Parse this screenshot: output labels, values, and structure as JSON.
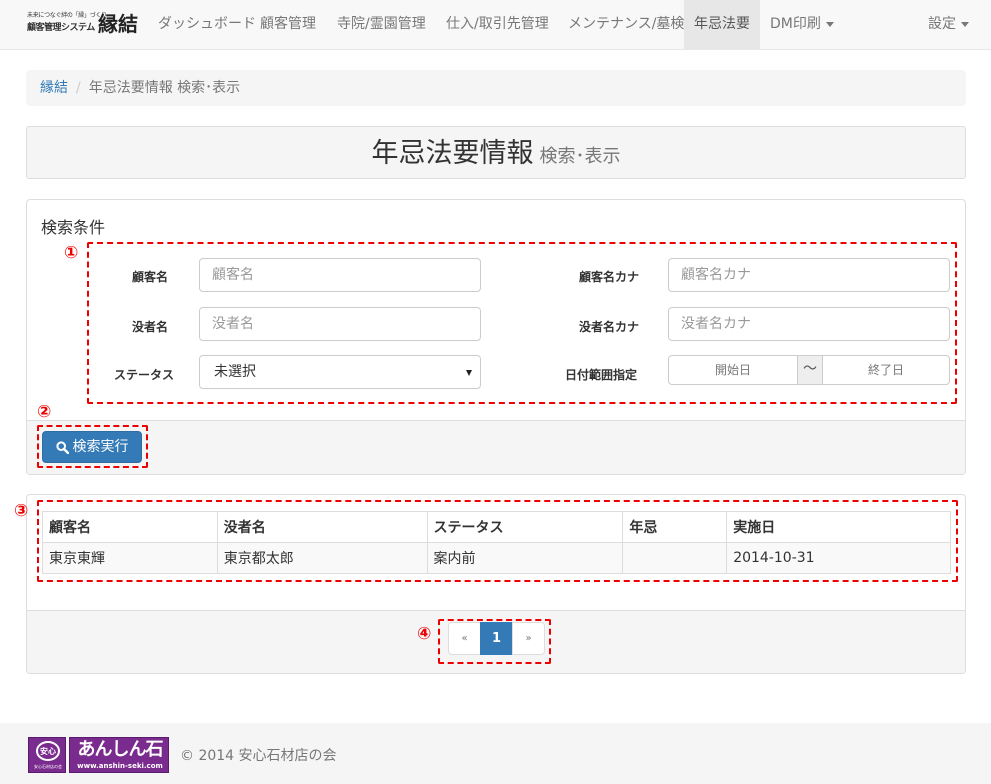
{
  "brand": {
    "tagline": "未来につなぐ絆の「縁」づくり",
    "system": "顧客管理システム",
    "name": "縁結"
  },
  "nav": {
    "items": [
      {
        "label": "ダッシュボード"
      },
      {
        "label": "顧客管理"
      },
      {
        "label": "寺院/霊園管理"
      },
      {
        "label": "仕入/取引先管理"
      },
      {
        "label": "メンテナンス/墓検"
      },
      {
        "label": "年忌法要"
      },
      {
        "label": "DM印刷"
      }
    ],
    "settings": "設定"
  },
  "breadcrumb": {
    "home": "縁結",
    "current": "年忌法要情報 検索･表示"
  },
  "header": {
    "title": "年忌法要情報",
    "subtitle": "検索･表示"
  },
  "search": {
    "heading": "検索条件",
    "customer_name": {
      "label": "顧客名",
      "placeholder": "顧客名"
    },
    "customer_kana": {
      "label": "顧客名カナ",
      "placeholder": "顧客名カナ"
    },
    "deceased_name": {
      "label": "没者名",
      "placeholder": "没者名"
    },
    "deceased_kana": {
      "label": "没者名カナ",
      "placeholder": "没者名カナ"
    },
    "status": {
      "label": "ステータス",
      "value": "未選択"
    },
    "date_range": {
      "label": "日付範囲指定",
      "start": "開始日",
      "separator": "〜",
      "end": "終了日"
    },
    "submit": "検索実行"
  },
  "markers": [
    "①",
    "②",
    "③",
    "④"
  ],
  "results": {
    "columns": [
      "顧客名",
      "没者名",
      "ステータス",
      "年忌",
      "実施日"
    ],
    "rows": [
      [
        "東京東輝",
        "東京都太郎",
        "案内前",
        "",
        "2014-10-31"
      ]
    ]
  },
  "pagination": {
    "prev": "«",
    "current": "1",
    "next": "»"
  },
  "footer": {
    "logo_badge": "安心石材店の会",
    "logo_name": "あんしん石",
    "logo_url": "www.anshin-seki.com",
    "copyright": "© 2014 安心石材店の会"
  },
  "colors": {
    "primary": "#337ab7",
    "annotation": "#ee0000",
    "logo": "#7a2b8e"
  }
}
